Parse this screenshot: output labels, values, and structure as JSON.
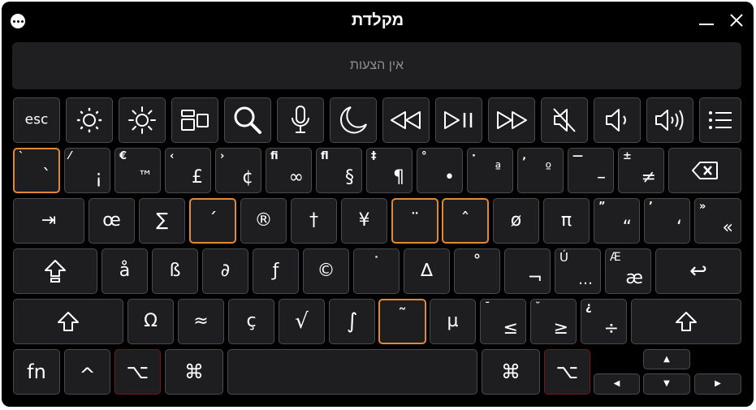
{
  "window": {
    "title": "מקלדת"
  },
  "suggestions": {
    "text": "אין הצעות"
  },
  "keys": {
    "esc": "esc",
    "backtick": {
      "main": "`",
      "top": "`"
    },
    "n1": {
      "main": "¡",
      "top": "⁄"
    },
    "n2": {
      "main": "™",
      "top": "€"
    },
    "n3": {
      "main": "£",
      "top": "‹"
    },
    "n4": {
      "main": "¢",
      "top": "›"
    },
    "n5": {
      "main": "∞",
      "top": "ﬁ"
    },
    "n6": {
      "main": "§",
      "top": "ﬂ"
    },
    "n7": {
      "main": "¶",
      "top": "‡"
    },
    "n8": {
      "main": "•",
      "top": "°"
    },
    "n9": {
      "main": "ª",
      "top": "·"
    },
    "n0": {
      "main": "º",
      "top": "‚"
    },
    "minus": {
      "main": "–",
      "top": "—"
    },
    "equal": {
      "main": "≠",
      "top": "±"
    },
    "q": "œ",
    "w": "∑",
    "e": "´",
    "r": "®",
    "t": "†",
    "y": "¥",
    "u": "¨",
    "i": "ˆ",
    "o": "ø",
    "p": "π",
    "lbracket": {
      "main": "“",
      "top": "”"
    },
    "rbracket": {
      "main": "‘",
      "top": "’"
    },
    "backslash": {
      "main": "«",
      "top": "»"
    },
    "a": "å",
    "s": "ß",
    "d": "∂",
    "f": "ƒ",
    "g": "©",
    "h": "˙",
    "j": "∆",
    "k": "˚",
    "l": "¬",
    "semicolon": {
      "main": "…",
      "top": "Ú"
    },
    "quote": {
      "main": "æ",
      "top": "Æ"
    },
    "z": "Ω",
    "x": "≈",
    "c": "ç",
    "v": "√",
    "b": "∫",
    "n": "˜",
    "m": "µ",
    "comma": {
      "main": "≤",
      "top": "¯"
    },
    "period": {
      "main": "≥",
      "top": "˘"
    },
    "slash": {
      "main": "÷",
      "top": "¿"
    },
    "fn": "fn",
    "ctrl": "^",
    "opt": "⌥",
    "cmd": "⌘",
    "tab": "⇥",
    "return": "↩",
    "backspace": "⌫",
    "up": "▲",
    "down": "▼",
    "left": "◀",
    "right": "▶"
  }
}
